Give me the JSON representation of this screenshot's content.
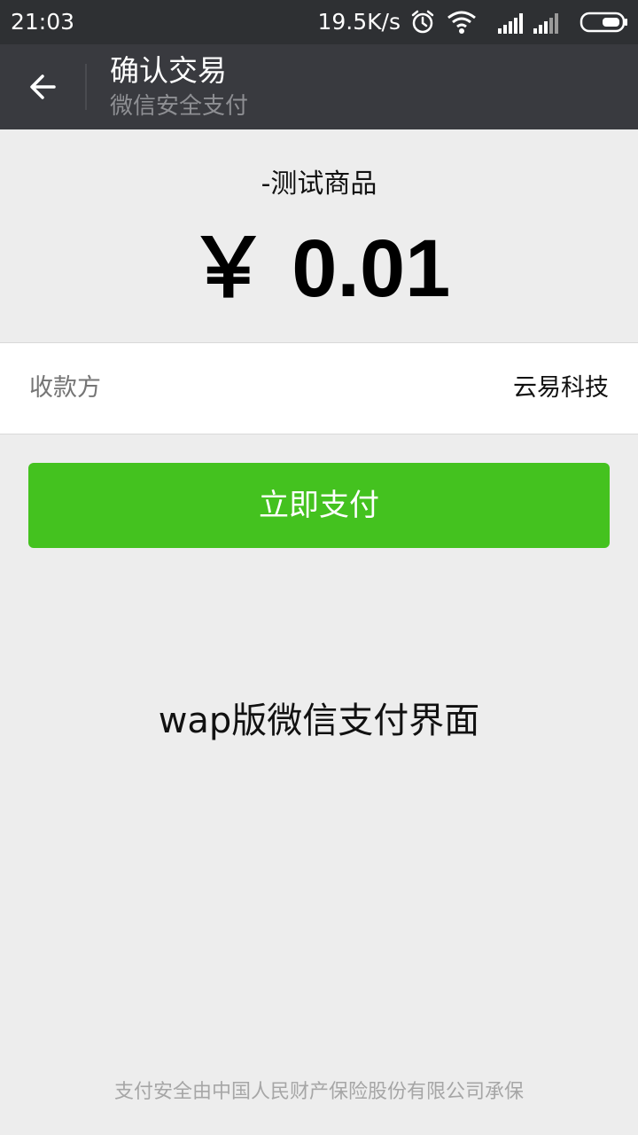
{
  "status_bar": {
    "time": "21:03",
    "net_speed": "19.5K/s",
    "icons": [
      "alarm-icon",
      "wifi-icon",
      "signal-icon",
      "signal-icon",
      "battery-icon"
    ]
  },
  "nav": {
    "back_icon": "arrow-left-icon",
    "title": "确认交易",
    "subtitle": "微信安全支付"
  },
  "order": {
    "product_name": "-测试商品",
    "price": "￥ 0.01"
  },
  "payee": {
    "label": "收款方",
    "value": "云易科技"
  },
  "actions": {
    "pay_label": "立即支付"
  },
  "caption": "wap版微信支付界面",
  "footer": "支付安全由中国人民财产保险股份有限公司承保",
  "colors": {
    "status_bar_bg": "#2e3033",
    "nav_bg": "#393a3f",
    "page_bg": "#ededed",
    "pay_button": "#44c21f"
  }
}
